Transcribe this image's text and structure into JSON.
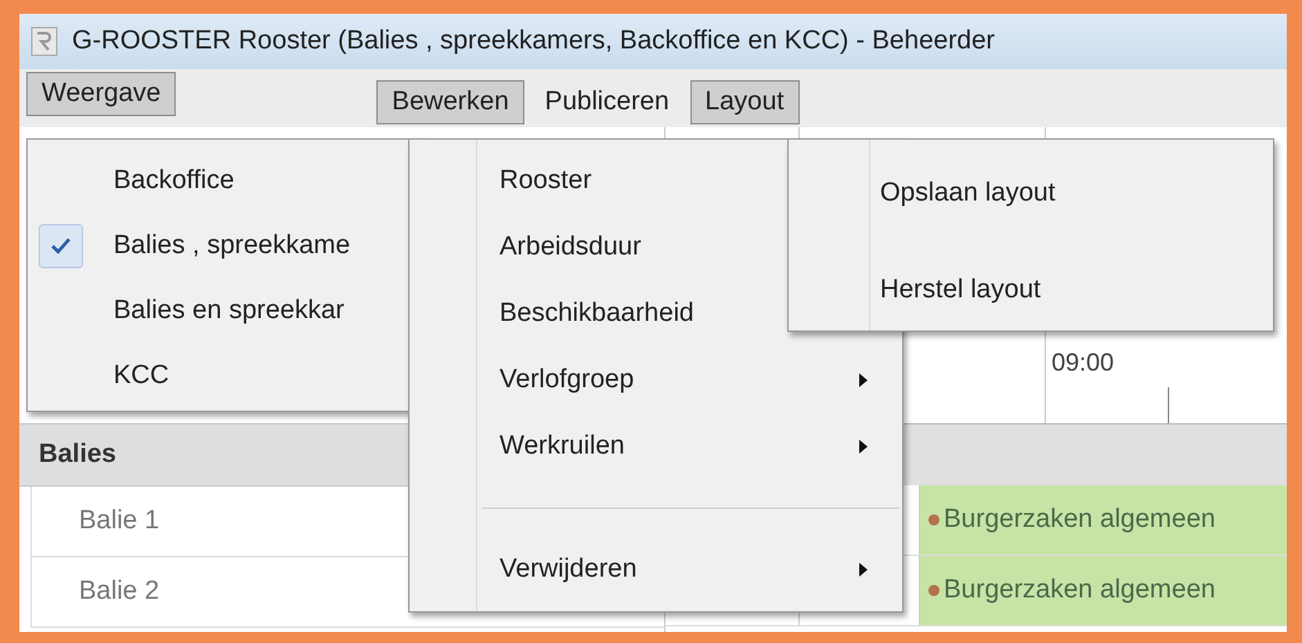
{
  "window": {
    "title": "G-ROOSTER Rooster (Balies , spreekkamers, Backoffice en KCC) - Beheerder"
  },
  "menubar": [
    {
      "label": "Weergave",
      "open": true
    },
    {
      "label": "Bewerken",
      "open": true
    },
    {
      "label": "Publiceren",
      "open": false
    },
    {
      "label": "Layout",
      "open": true
    }
  ],
  "weergave_menu": [
    {
      "label": "Backoffice",
      "checked": false
    },
    {
      "label": "Balies , spreekkame",
      "checked": true
    },
    {
      "label": "Balies en spreekkar",
      "checked": false
    },
    {
      "label": "KCC",
      "checked": false
    }
  ],
  "bewerken_menu": [
    {
      "kind": "item",
      "label": "Rooster"
    },
    {
      "kind": "item",
      "label": "Arbeidsduur"
    },
    {
      "kind": "item",
      "label": "Beschikbaarheid"
    },
    {
      "kind": "item",
      "label": "Verlofgroep",
      "submenu": true
    },
    {
      "kind": "item",
      "label": "Werkruilen",
      "submenu": true
    },
    {
      "kind": "separator"
    },
    {
      "kind": "item",
      "label": "Verwijderen",
      "submenu": true
    }
  ],
  "layout_menu": [
    {
      "label": "Opslaan layout"
    },
    {
      "label": "Herstel layout"
    }
  ],
  "schedule": {
    "time": "09:00",
    "group": "Balies",
    "rows": [
      {
        "name": "Balie 1",
        "event": "Burgerzaken algemeen"
      },
      {
        "name": "Balie 2",
        "event": "Burgerzaken algemeen"
      }
    ]
  }
}
